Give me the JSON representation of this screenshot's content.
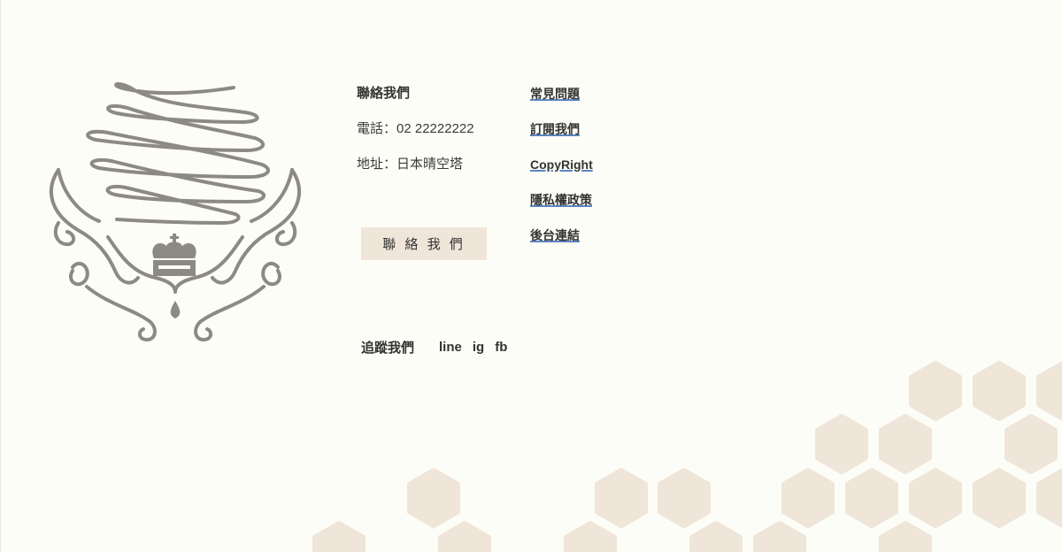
{
  "contact": {
    "title": "聯絡我們",
    "phone": "電話：02 22222222",
    "address": "地址：日本晴空塔",
    "button_label": "聯 絡 我 們"
  },
  "links": [
    {
      "label": "常見問題"
    },
    {
      "label": "訂閱我們"
    },
    {
      "label": "CopyRight"
    },
    {
      "label": "隱私權政策"
    },
    {
      "label": "後台連結"
    }
  ],
  "follow": {
    "title": "追蹤我們",
    "socials": [
      {
        "label": "line"
      },
      {
        "label": "ig"
      },
      {
        "label": "fb"
      }
    ]
  },
  "colors": {
    "background": "#fdfdf7",
    "hexagon": "#efe5d8",
    "logo": "#8c8a82",
    "link_underline": "#5b86c3"
  }
}
